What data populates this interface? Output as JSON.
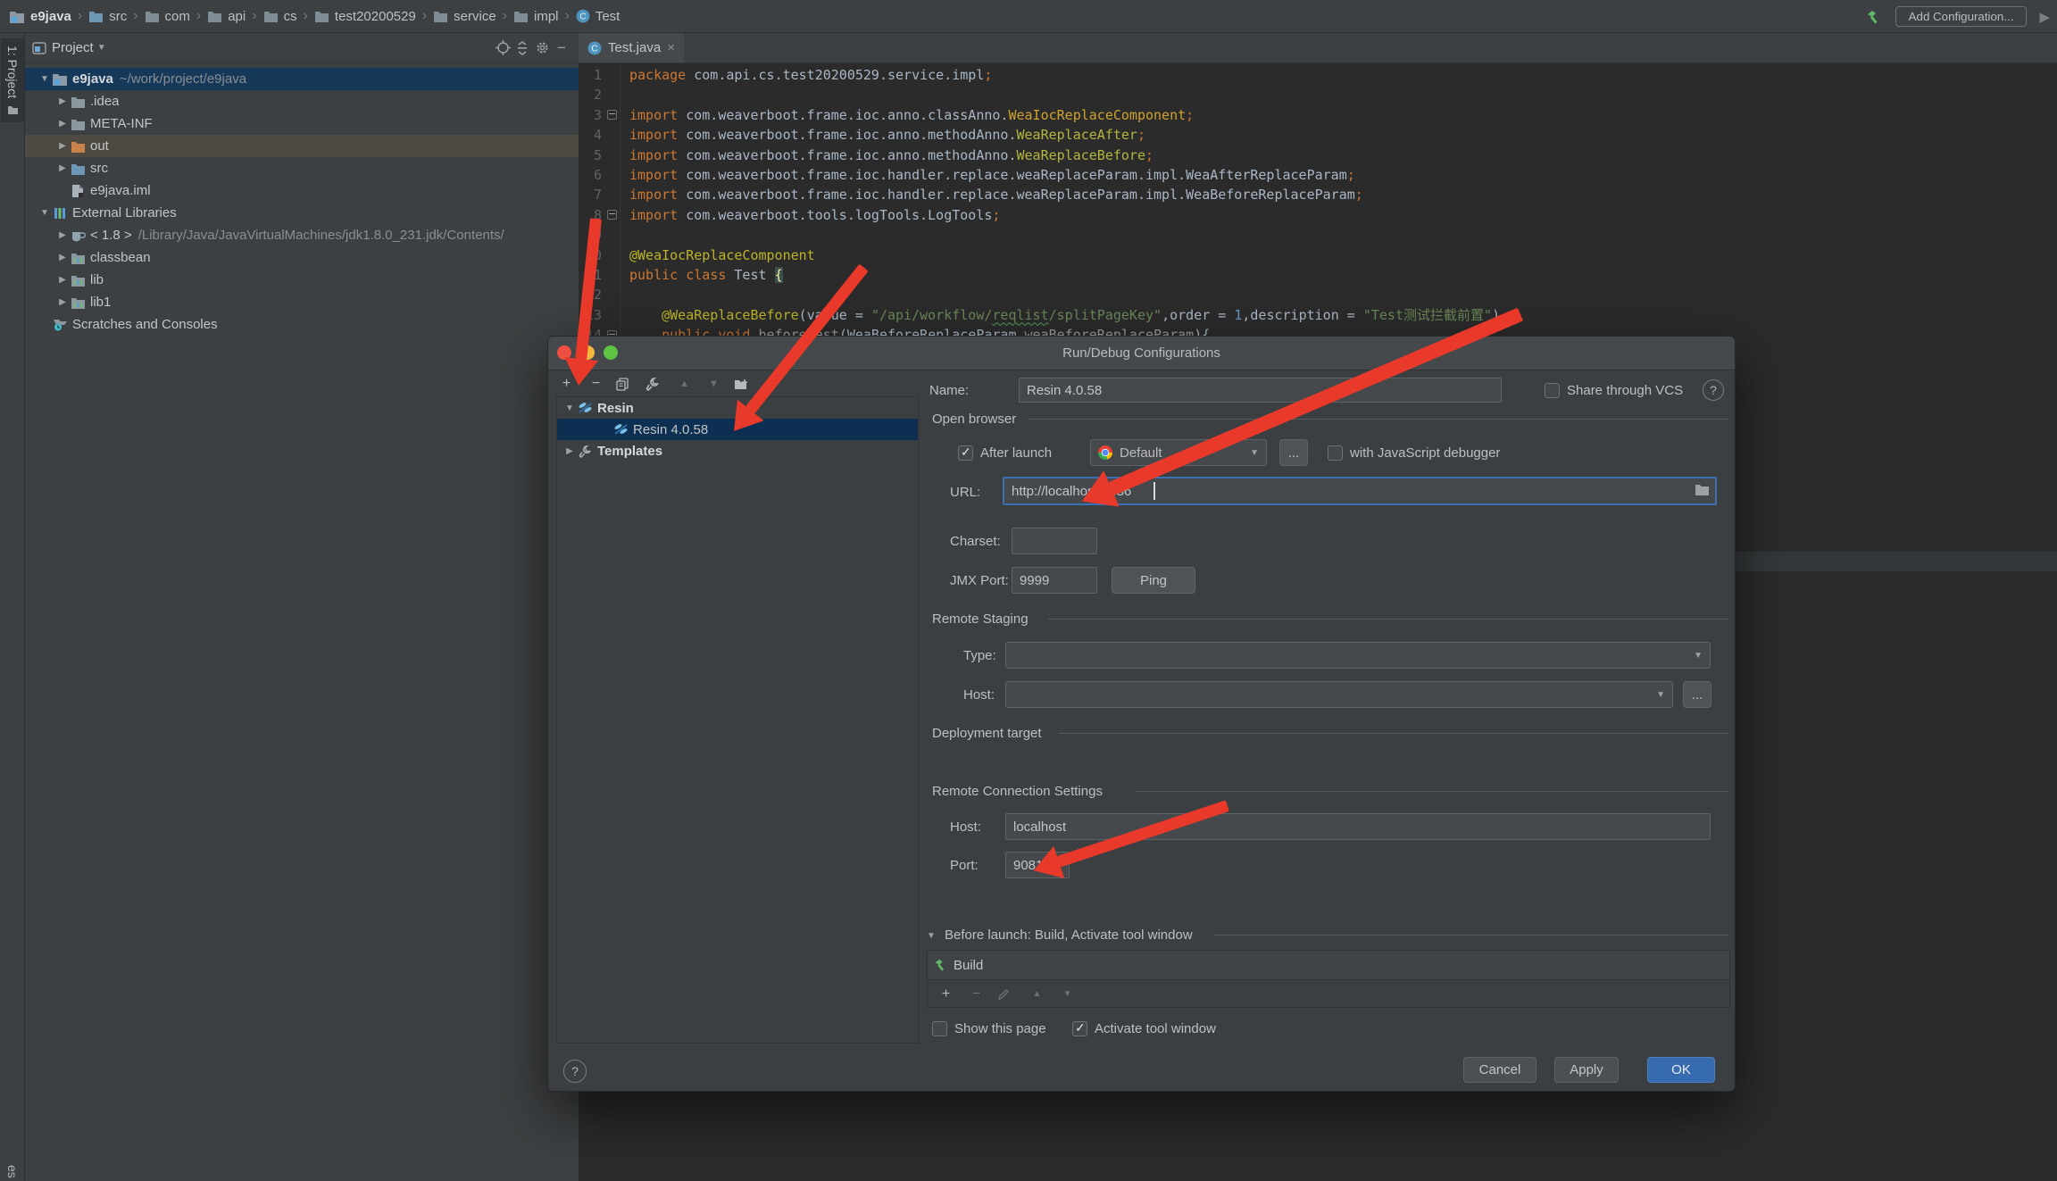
{
  "colors": {
    "panel_bg": "#3d4042",
    "editor_bg": "#2b2b2b",
    "dialog_bg": "#3c3f41",
    "selection_blue": "#16395a",
    "dialog_selection": "#0d2f52",
    "excluded_row": "#4e4a42",
    "arrow_red": "#e8392b",
    "ok_blue": "#366bb0",
    "keyword_orange": "#cc7832",
    "string_green": "#6a8759",
    "number_blue": "#6897bb",
    "annotation_yellow": "#bbb529",
    "focus_border_blue": "#3d6fb5",
    "traffic_red": "#ee4f42",
    "traffic_yellow": "#f6b73e",
    "traffic_green": "#5ec343"
  },
  "icons": {
    "chevron": "›",
    "arrow_down": "▼",
    "arrow_right": "▶",
    "plus": "+",
    "minus": "−",
    "up": "▲",
    "down": "▼",
    "play": "▶",
    "close": "×",
    "combo_arrow": "▼",
    "help": "?",
    "more": "..."
  },
  "top_bar": {
    "breadcrumbs": [
      {
        "label": "e9java",
        "icon": "project"
      },
      {
        "label": "src",
        "icon": "folder-blue"
      },
      {
        "label": "com",
        "icon": "package"
      },
      {
        "label": "api",
        "icon": "package"
      },
      {
        "label": "cs",
        "icon": "package"
      },
      {
        "label": "test20200529",
        "icon": "package"
      },
      {
        "label": "service",
        "icon": "package"
      },
      {
        "label": "impl",
        "icon": "package"
      },
      {
        "label": "Test",
        "icon": "class"
      }
    ],
    "add_configuration": "Add Configuration..."
  },
  "tool_strip": {
    "project_button": "1: Project",
    "bottom_partial": "es"
  },
  "project_panel": {
    "title": "Project",
    "tree": [
      {
        "indent": 0,
        "arrow": "down",
        "icon": "project",
        "label": "e9java",
        "extra": "~/work/project/e9java",
        "selected": true,
        "bold": true
      },
      {
        "indent": 1,
        "arrow": "right",
        "icon": "folder-gray",
        "label": ".idea"
      },
      {
        "indent": 1,
        "arrow": "right",
        "icon": "folder-gray",
        "label": "META-INF"
      },
      {
        "indent": 1,
        "arrow": "right",
        "icon": "folder-orange",
        "label": "out",
        "hilite": true
      },
      {
        "indent": 1,
        "arrow": "right",
        "icon": "folder-blue",
        "label": "src"
      },
      {
        "indent": 1,
        "arrow": "",
        "icon": "file",
        "label": "e9java.iml"
      },
      {
        "indent": 0,
        "arrow": "down",
        "icon": "libraries",
        "label": "External Libraries"
      },
      {
        "indent": 1,
        "arrow": "right",
        "icon": "jdk",
        "label": "< 1.8 >",
        "extra": "/Library/Java/JavaVirtualMachines/jdk1.8.0_231.jdk/Contents/"
      },
      {
        "indent": 1,
        "arrow": "right",
        "icon": "lib",
        "label": "classbean"
      },
      {
        "indent": 1,
        "arrow": "right",
        "icon": "lib",
        "label": "lib"
      },
      {
        "indent": 1,
        "arrow": "right",
        "icon": "lib",
        "label": "lib1"
      },
      {
        "indent": 0,
        "arrow": "",
        "icon": "scratches",
        "label": "Scratches and Consoles"
      }
    ]
  },
  "editor": {
    "tab": {
      "label": "Test.java"
    },
    "lines": [
      {
        "n": "1",
        "tokens": [
          {
            "t": "package ",
            "c": "kw"
          },
          {
            "t": "com.api.cs.test20200529.service.impl",
            "c": "pl"
          },
          {
            "t": ";",
            "c": "kw"
          }
        ]
      },
      {
        "n": "2",
        "tokens": []
      },
      {
        "n": "3",
        "fold": true,
        "tokens": [
          {
            "t": "import ",
            "c": "kw"
          },
          {
            "t": "com.weaverboot.frame.ioc.anno.classAnno.",
            "c": "pl"
          },
          {
            "t": "WeaIocReplaceComponent",
            "c": "c1"
          },
          {
            "t": ";",
            "c": "kw"
          }
        ]
      },
      {
        "n": "4",
        "tokens": [
          {
            "t": "import ",
            "c": "kw"
          },
          {
            "t": "com.weaverboot.frame.ioc.anno.methodAnno.",
            "c": "pl"
          },
          {
            "t": "WeaReplaceAfter",
            "c": "c2"
          },
          {
            "t": ";",
            "c": "kw"
          }
        ]
      },
      {
        "n": "5",
        "tokens": [
          {
            "t": "import ",
            "c": "kw"
          },
          {
            "t": "com.weaverboot.frame.ioc.anno.methodAnno.",
            "c": "pl"
          },
          {
            "t": "WeaReplaceBefore",
            "c": "c2"
          },
          {
            "t": ";",
            "c": "kw"
          }
        ]
      },
      {
        "n": "6",
        "tokens": [
          {
            "t": "import ",
            "c": "kw"
          },
          {
            "t": "com.weaverboot.frame.ioc.handler.replace.weaReplaceParam.impl.WeaAfterReplaceParam",
            "c": "pl"
          },
          {
            "t": ";",
            "c": "kw"
          }
        ]
      },
      {
        "n": "7",
        "tokens": [
          {
            "t": "import ",
            "c": "kw"
          },
          {
            "t": "com.weaverboot.frame.ioc.handler.replace.weaReplaceParam.impl.WeaBeforeReplaceParam",
            "c": "pl"
          },
          {
            "t": ";",
            "c": "kw"
          }
        ]
      },
      {
        "n": "8",
        "fold": true,
        "tokens": [
          {
            "t": "import ",
            "c": "kw"
          },
          {
            "t": "com.weaverboot.tools.logTools.LogTools",
            "c": "pl"
          },
          {
            "t": ";",
            "c": "kw"
          }
        ]
      },
      {
        "n": "9",
        "tokens": []
      },
      {
        "n": "10",
        "tokens": [
          {
            "t": "@WeaIocReplaceComponent",
            "c": "an"
          }
        ]
      },
      {
        "n": "11",
        "tokens": [
          {
            "t": "public class ",
            "c": "kw"
          },
          {
            "t": "Test ",
            "c": "pl"
          },
          {
            "t": "{",
            "c": "br"
          }
        ]
      },
      {
        "n": "12",
        "tokens": []
      },
      {
        "n": "13",
        "tokens": [
          {
            "t": "    ",
            "c": "pl"
          },
          {
            "t": "@WeaReplaceBefore",
            "c": "an"
          },
          {
            "t": "(",
            "c": "pl"
          },
          {
            "t": "value",
            "c": "pl"
          },
          {
            "t": " = ",
            "c": "pl"
          },
          {
            "t": "\"/api/workflow/",
            "c": "st"
          },
          {
            "t": "reqlist",
            "c": "stu"
          },
          {
            "t": "/splitPageKey\"",
            "c": "st"
          },
          {
            "t": ",",
            "c": "pl"
          },
          {
            "t": "order",
            "c": "pl"
          },
          {
            "t": " = ",
            "c": "pl"
          },
          {
            "t": "1",
            "c": "nu"
          },
          {
            "t": ",",
            "c": "pl"
          },
          {
            "t": "description",
            "c": "pl"
          },
          {
            "t": " = ",
            "c": "pl"
          },
          {
            "t": "\"Test测试拦截前置\"",
            "c": "st"
          },
          {
            "t": ")",
            "c": "pl"
          }
        ]
      },
      {
        "n": "14",
        "fold": true,
        "tokens": [
          {
            "t": "    ",
            "c": "pl"
          },
          {
            "t": "public void ",
            "c": "kw"
          },
          {
            "t": "beforeTest",
            "c": "mt"
          },
          {
            "t": "(",
            "c": "pl"
          },
          {
            "t": "WeaBeforeReplaceParam",
            "c": "pl"
          },
          {
            "t": " ",
            "c": "pl"
          },
          {
            "t": "weaBeforeReplaceParam",
            "c": "mt"
          },
          {
            "t": "){",
            "c": "pl"
          }
        ]
      }
    ]
  },
  "dialog": {
    "title": "Run/Debug Configurations",
    "tree": [
      {
        "indent": 0,
        "arrow": "down",
        "icon": "resin",
        "label": "Resin",
        "bold": true
      },
      {
        "indent": 1,
        "arrow": "",
        "icon": "resin",
        "label": "Resin 4.0.58",
        "selected": true
      },
      {
        "indent": 0,
        "arrow": "right",
        "icon": "wrench",
        "label": "Templates",
        "bold": true
      }
    ],
    "form": {
      "name_label": "Name:",
      "name_value": "Resin 4.0.58",
      "share_vcs": "Share through VCS",
      "open_browser": "Open browser",
      "after_launch": "After launch",
      "browser_value": "Default",
      "browse_more": "...",
      "js_debugger": "with JavaScript debugger",
      "url_label": "URL:",
      "url_value": "http://localhost:8886",
      "charset_label": "Charset:",
      "charset_value": "",
      "jmx_label": "JMX Port:",
      "jmx_value": "9999",
      "ping": "Ping",
      "remote_staging": "Remote Staging",
      "type_label": "Type:",
      "host_label": "Host:",
      "host_more": "...",
      "deployment_target": "Deployment target",
      "rcs": "Remote Connection Settings",
      "rcs_host_label": "Host:",
      "rcs_host_value": "localhost",
      "rcs_port_label": "Port:",
      "rcs_port_value": "9081"
    },
    "before_launch": {
      "header": "Before launch: Build, Activate tool window",
      "item": "Build",
      "show_this_page": "Show this page",
      "activate_tool_window": "Activate tool window"
    },
    "buttons": {
      "cancel": "Cancel",
      "apply": "Apply",
      "ok": "OK",
      "help": "?"
    }
  }
}
